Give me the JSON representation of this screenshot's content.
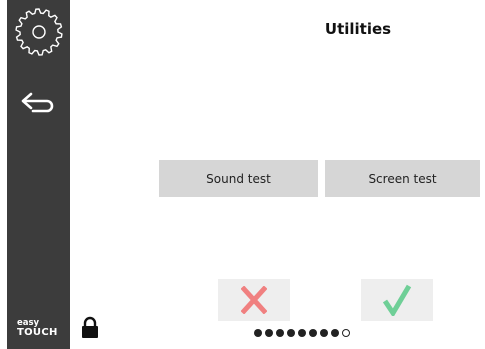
{
  "sidebar": {
    "icons": [
      "gear-icon",
      "back-arrow-icon"
    ],
    "brand_line1": "easy",
    "brand_line2": "TOUCH"
  },
  "lock_icon": "lock-icon",
  "page": {
    "title": "Utilities"
  },
  "buttons": {
    "sound_test": "Sound test",
    "screen_test": "Screen test"
  },
  "actions": {
    "cancel_icon": "x-icon",
    "confirm_icon": "check-icon",
    "cancel_color": "#f08080",
    "confirm_color": "#6fcf97"
  },
  "pagination": {
    "pages": 9,
    "current": 9
  }
}
